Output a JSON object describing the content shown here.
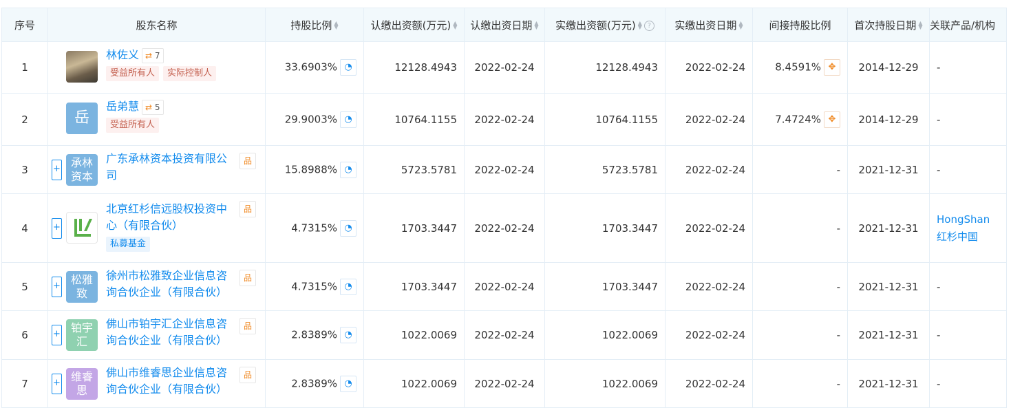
{
  "headers": {
    "seq": "序号",
    "name": "股东名称",
    "ratio": "持股比例",
    "sub_amount": "认缴出资额(万元)",
    "sub_date": "认缴出资日期",
    "paid_amount": "实缴出资额(万元)",
    "paid_date": "实缴出资日期",
    "indirect": "间接持股比例",
    "first_date": "首次持股日期",
    "related": "关联产品/机构"
  },
  "rows": [
    {
      "seq": "1",
      "logo_text": "",
      "name": "林佐义",
      "path_count": "7",
      "tags": [
        "受益所有人",
        "实际控制人"
      ],
      "ratio": "33.6903%",
      "sub_amount": "12128.4943",
      "sub_date": "2022-02-24",
      "paid_amount": "12128.4943",
      "paid_date": "2022-02-24",
      "indirect": "8.4591%",
      "first_date": "2014-12-29",
      "related": "-"
    },
    {
      "seq": "2",
      "logo_text": "岳",
      "name": "岳弟慧",
      "path_count": "5",
      "tags": [
        "受益所有人"
      ],
      "ratio": "29.9003%",
      "sub_amount": "10764.1155",
      "sub_date": "2022-02-24",
      "paid_amount": "10764.1155",
      "paid_date": "2022-02-24",
      "indirect": "7.4724%",
      "first_date": "2014-12-29",
      "related": "-"
    },
    {
      "seq": "3",
      "logo_text": "承林资本",
      "name": "广东承林资本投资有限公司",
      "ratio": "15.8988%",
      "sub_amount": "5723.5781",
      "sub_date": "2022-02-24",
      "paid_amount": "5723.5781",
      "paid_date": "2022-02-24",
      "indirect": "-",
      "first_date": "2021-12-31",
      "related": "-"
    },
    {
      "seq": "4",
      "logo_text": "",
      "name": "北京红杉信远股权投资中心（有限合伙）",
      "tags": [
        "私募基金"
      ],
      "ratio": "4.7315%",
      "sub_amount": "1703.3447",
      "sub_date": "2022-02-24",
      "paid_amount": "1703.3447",
      "paid_date": "2022-02-24",
      "indirect": "-",
      "first_date": "2021-12-31",
      "related": "HongShan红杉中国"
    },
    {
      "seq": "5",
      "logo_text": "松雅致",
      "name": "徐州市松雅致企业信息咨询合伙企业（有限合伙）",
      "ratio": "4.7315%",
      "sub_amount": "1703.3447",
      "sub_date": "2022-02-24",
      "paid_amount": "1703.3447",
      "paid_date": "2022-02-24",
      "indirect": "-",
      "first_date": "2021-12-31",
      "related": "-"
    },
    {
      "seq": "6",
      "logo_text": "铂宇汇",
      "name": "佛山市铂宇汇企业信息咨询合伙企业（有限合伙）",
      "ratio": "2.8389%",
      "sub_amount": "1022.0069",
      "sub_date": "2022-02-24",
      "paid_amount": "1022.0069",
      "paid_date": "2022-02-24",
      "indirect": "-",
      "first_date": "2021-12-31",
      "related": "-"
    },
    {
      "seq": "7",
      "logo_text": "维睿思",
      "name": "佛山市维睿思企业信息咨询合伙企业（有限合伙）",
      "ratio": "2.8389%",
      "sub_amount": "1022.0069",
      "sub_date": "2022-02-24",
      "paid_amount": "1022.0069",
      "paid_date": "2022-02-24",
      "indirect": "-",
      "first_date": "2021-12-31",
      "related": "-"
    }
  ],
  "colors": {
    "link": "#128bed",
    "header_bg": "#f2f9fc",
    "logo_blue": "#7bb4e0",
    "logo_green": "#8fd1b0",
    "logo_purple": "#c3a6e6"
  },
  "icons": {
    "path": "path-icon",
    "org": "org-chart-icon",
    "pie": "pie-chart-icon",
    "indirect": "indirect-path-icon",
    "expand": "plus-icon",
    "help": "question-icon"
  }
}
